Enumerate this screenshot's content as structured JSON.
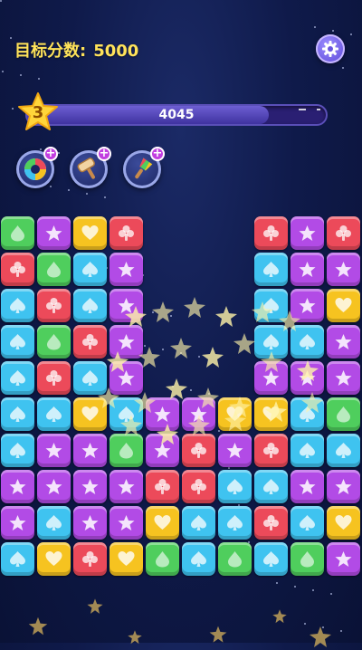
{
  "header": {
    "target_label": "目标分数:",
    "target_value": "5000",
    "settings_icon": "gear-icon"
  },
  "progress": {
    "level": "3",
    "score": "4045",
    "fill_fraction": 0.81
  },
  "boosters": [
    {
      "name": "color-wheel-booster",
      "icon": "color-wheel-icon",
      "plus": "+"
    },
    {
      "name": "hammer-booster",
      "icon": "hammer-icon",
      "plus": "+"
    },
    {
      "name": "brush-booster",
      "icon": "paintbrush-icon",
      "plus": "+"
    }
  ],
  "colors": {
    "green": "#4fce5d",
    "purple": "#b24be6",
    "yellow": "#f6c320",
    "red": "#ec4a5a",
    "blue": "#3fc3f0",
    "accent_text": "#ffe35a"
  },
  "shapes": {
    "green": "drop",
    "purple": "star",
    "yellow": "heart",
    "red": "club",
    "blue": "spade"
  },
  "board": {
    "columns": 10,
    "rows": 10,
    "grid": [
      [
        "green",
        "purple",
        "yellow",
        "red",
        null,
        null,
        null,
        "red",
        "purple",
        "red"
      ],
      [
        "red",
        "green",
        "blue",
        "purple",
        null,
        null,
        null,
        "blue",
        "purple",
        "purple"
      ],
      [
        "blue",
        "red",
        "blue",
        "purple",
        null,
        null,
        null,
        "blue",
        "purple",
        "yellow"
      ],
      [
        "blue",
        "green",
        "red",
        "purple",
        null,
        null,
        null,
        "blue",
        "blue",
        "purple"
      ],
      [
        "blue",
        "red",
        "blue",
        "purple",
        null,
        null,
        null,
        "purple",
        "purple",
        "purple"
      ],
      [
        "blue",
        "blue",
        "yellow",
        "blue",
        "purple",
        "purple",
        "yellow",
        "yellow",
        "blue",
        "green"
      ],
      [
        "blue",
        "purple",
        "purple",
        "green",
        "purple",
        "red",
        "purple",
        "red",
        "blue",
        "blue"
      ],
      [
        "purple",
        "purple",
        "purple",
        "purple",
        "red",
        "red",
        "blue",
        "blue",
        "purple",
        "purple"
      ],
      [
        "purple",
        "blue",
        "purple",
        "purple",
        "yellow",
        "blue",
        "blue",
        "red",
        "blue",
        "yellow"
      ],
      [
        "blue",
        "yellow",
        "red",
        "yellow",
        "green",
        "blue",
        "green",
        "blue",
        "green",
        "purple"
      ]
    ]
  }
}
